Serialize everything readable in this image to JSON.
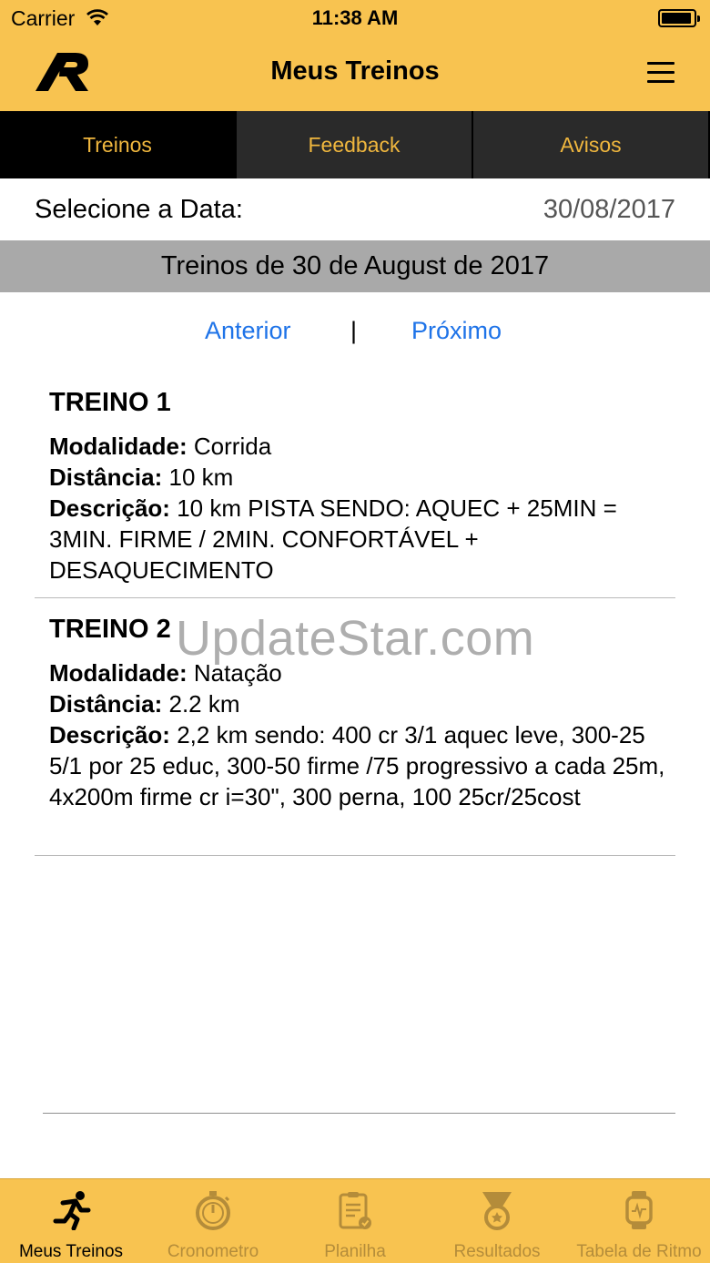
{
  "status": {
    "carrier": "Carrier",
    "time": "11:38 AM"
  },
  "header": {
    "title": "Meus Treinos"
  },
  "tabs": [
    {
      "label": "Treinos",
      "active": true
    },
    {
      "label": "Feedback",
      "active": false
    },
    {
      "label": "Avisos",
      "active": false
    }
  ],
  "date_selector": {
    "label": "Selecione a Data:",
    "value": "30/08/2017"
  },
  "day_header": "Treinos de 30 de August de 2017",
  "pager": {
    "previous": "Anterior",
    "separator": "|",
    "next": "Próximo"
  },
  "workouts": [
    {
      "title": "TREINO 1",
      "modality_label": "Modalidade:",
      "modality": "Corrida",
      "distance_label": "Distância:",
      "distance": "10 km",
      "description_label": "Descrição:",
      "description": "10 km PISTA SENDO: AQUEC + 25MIN = 3MIN. FIRME / 2MIN. CONFORTÁVEL + DESAQUECIMENTO"
    },
    {
      "title": "TREINO 2",
      "modality_label": "Modalidade:",
      "modality": "Natação",
      "distance_label": "Distância:",
      "distance": "2.2 km",
      "description_label": "Descrição:",
      "description": "2,2 km sendo: 400 cr 3/1 aquec leve, 300-25  5/1 por 25 educ, 300-50 firme /75 progressivo a cada 25m, 4x200m firme cr i=30\", 300 perna, 100 25cr/25cost"
    }
  ],
  "watermark": "UpdateStar.com",
  "tabbar": [
    {
      "label": "Meus Treinos",
      "icon": "runner-icon",
      "active": true
    },
    {
      "label": "Cronometro",
      "icon": "stopwatch-icon",
      "active": false
    },
    {
      "label": "Planilha",
      "icon": "clipboard-icon",
      "active": false
    },
    {
      "label": "Resultados",
      "icon": "medal-icon",
      "active": false
    },
    {
      "label": "Tabela de Ritmo",
      "icon": "smartwatch-icon",
      "active": false
    }
  ],
  "colors": {
    "accent": "#f8c350",
    "tab_text": "#f0b73e",
    "link": "#1e73e8",
    "inactive_icon": "#b48c3a"
  }
}
